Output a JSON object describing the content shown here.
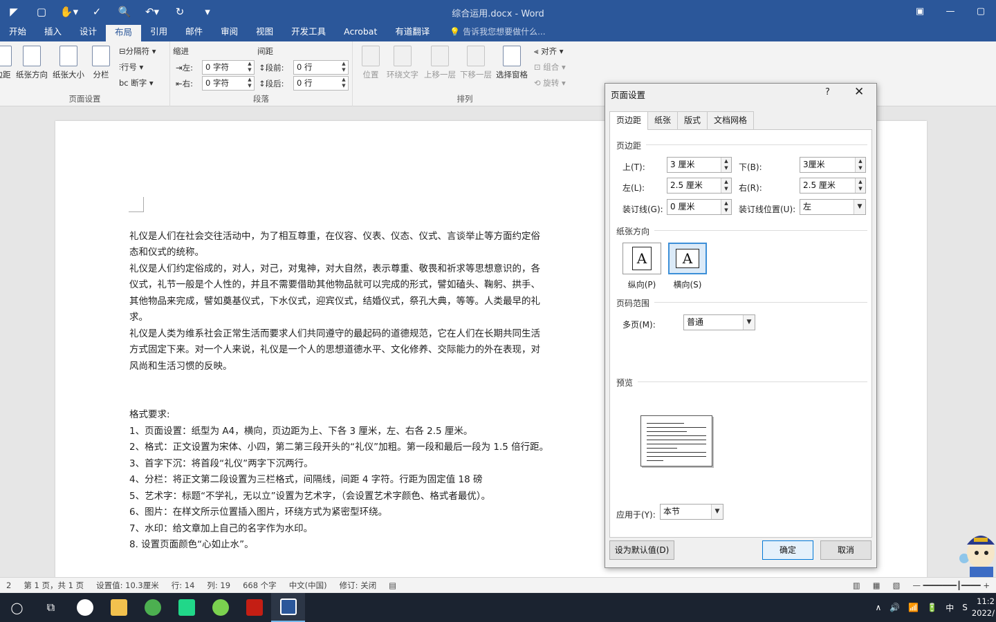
{
  "app": {
    "title": "综合运用.docx - Word"
  },
  "qat": {
    "items": [
      "◤",
      "▢",
      "✋▾",
      "✓",
      "🔍",
      "↶▾",
      "↻",
      "▾"
    ]
  },
  "window_buttons": [
    "▣",
    "—",
    "▢"
  ],
  "tabs": [
    {
      "label": "开始",
      "active": false
    },
    {
      "label": "插入",
      "active": false
    },
    {
      "label": "设计",
      "active": false
    },
    {
      "label": "布局",
      "active": true
    },
    {
      "label": "引用",
      "active": false
    },
    {
      "label": "邮件",
      "active": false
    },
    {
      "label": "审阅",
      "active": false
    },
    {
      "label": "视图",
      "active": false
    },
    {
      "label": "开发工具",
      "active": false
    },
    {
      "label": "Acrobat",
      "active": false
    },
    {
      "label": "有道翻译",
      "active": false
    }
  ],
  "tell_me": "告诉我您想要做什么...",
  "ribbon": {
    "page_setup": {
      "label": "页面设置",
      "margins": "边距",
      "orientation": "纸张方向",
      "size": "纸张大小",
      "columns": "分栏",
      "breaks": "分隔符",
      "line_numbers": "行号",
      "hyphenation": "断字"
    },
    "paragraph": {
      "label": "段落",
      "indent": "缩进",
      "spacing": "间距",
      "left_label": "左:",
      "left_value": "0 字符",
      "right_label": "右:",
      "right_value": "0 字符",
      "before_label": "段前:",
      "before_value": "0 行",
      "after_label": "段后:",
      "after_value": "0 行"
    },
    "arrange": {
      "label": "排列",
      "position": "位置",
      "wrap": "环绕文字",
      "forward": "上移一层",
      "backward": "下移一层",
      "pane": "选择窗格",
      "align": "对齐",
      "group": "组合",
      "rotate": "旋转"
    }
  },
  "document": {
    "paragraphs": [
      "礼仪是人们在社会交往活动中，为了相互尊重，在仪容、仪表、仪态、仪式、言谈举止等方面约定俗",
      "态和仪式的统称。",
      "礼仪是人们约定俗成的，对人，对己，对鬼神，对大自然，表示尊重、敬畏和祈求等思想意识的，各",
      "仪式，礼节一般是个人性的，并且不需要借助其他物品就可以完成的形式，譬如磕头、鞠躬、拱手、",
      "其他物品来完成，譬如奠基仪式，下水仪式，迎宾仪式，结婚仪式，祭孔大典，等等。人类最早的礼",
      "求。",
      "礼仪是人类为维系社会正常生活而要求人们共同遵守的最起码的道德规范，它在人们在长期共同生活",
      "方式固定下来。对一个人来说，礼仪是一个人的思想道德水平、文化修养、交际能力的外在表现，对",
      "风尚和生活习惯的反映。"
    ],
    "requirements_title": "格式要求:",
    "requirements": [
      "1、页面设置：纸型为 A4，横向，页边距为上、下各 3 厘米，左、右各 2.5 厘米。",
      "2、格式：正文设置为宋体、小四，第二第三段开头的“礼仪”加粗。第一段和最后一段为 1.5 倍行距。",
      "3、首字下沉：将首段“礼仪”两字下沉两行。",
      "4、分栏：将正文第二段设置为三栏格式，间隔线，间距 4 字符。行距为固定值 18 磅",
      "5、艺术字：标题“不学礼，无以立”设置为艺术字，（会设置艺术字颜色、格式者最优）。",
      "6、图片：在样文所示位置插入图片，环绕方式为紧密型环绕。",
      "7、水印：给文章加上自己的名字作为水印。",
      "8. 设置页面颜色“心如止水”。"
    ]
  },
  "status_bar": [
    "2",
    "第 1 页，共 1 页",
    "设置值: 10.3厘米",
    "行: 14",
    "列: 19",
    "668 个字",
    "中文(中国)",
    "修订: 关闭"
  ],
  "dialog": {
    "title": "页面设置",
    "help": "?",
    "close": "✕",
    "tabs": [
      "页边距",
      "纸张",
      "版式",
      "文档网格"
    ],
    "margins_section": "页边距",
    "top_label": "上(T):",
    "top_value": "3 厘米",
    "bottom_label": "下(B):",
    "bottom_value": "3厘米",
    "left_label": "左(L):",
    "left_value": "2.5 厘米",
    "right_label": "右(R):",
    "right_value": "2.5 厘米",
    "gutter_label": "装订线(G):",
    "gutter_value": "0 厘米",
    "gutter_pos_label": "装订线位置(U):",
    "gutter_pos_value": "左",
    "orientation_section": "纸张方向",
    "portrait_label": "纵向(P)",
    "landscape_label": "横向(S)",
    "orientation_glyph": "A",
    "pages_section": "页码范围",
    "multiple_label": "多页(M):",
    "multiple_value": "普通",
    "preview_section": "预览",
    "apply_label": "应用于(Y):",
    "apply_value": "本节",
    "default_button": "设为默认值(D)",
    "ok_button": "确定",
    "cancel_button": "取消"
  },
  "tray": {
    "items": [
      "∧",
      "🔊",
      "📶",
      "🔋",
      "中",
      "S"
    ],
    "time": "11:2",
    "date": "2022/"
  },
  "colors": {
    "accent": "#2b579a",
    "taskbar": "#1b2330",
    "focus": "#0078d7"
  }
}
